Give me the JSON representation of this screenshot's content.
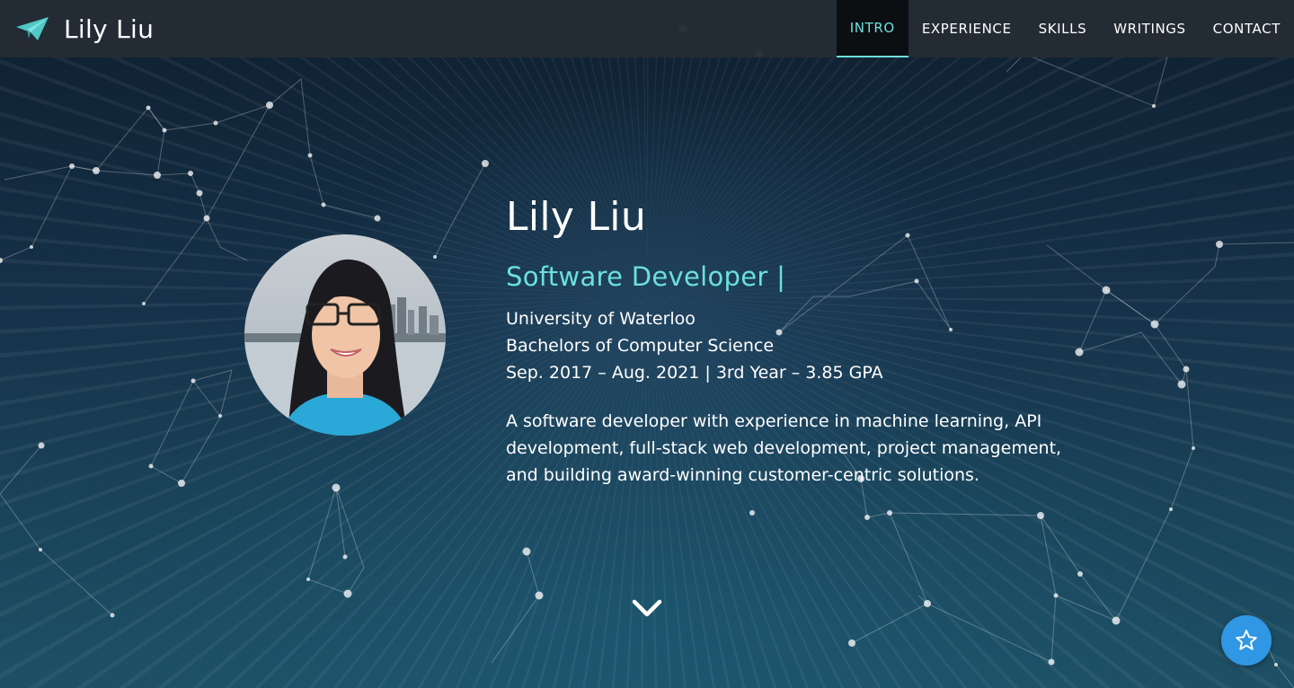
{
  "navbar": {
    "brand_name": "Lily Liu",
    "brand_icon": "paper-plane-icon",
    "items": [
      {
        "label": "INTRO",
        "active": true
      },
      {
        "label": "EXPERIENCE",
        "active": false
      },
      {
        "label": "SKILLS",
        "active": false
      },
      {
        "label": "WRITINGS",
        "active": false
      },
      {
        "label": "CONTACT",
        "active": false
      }
    ]
  },
  "hero": {
    "name": "Lily Liu",
    "role": "Software Developer |",
    "education": [
      "University of Waterloo",
      "Bachelors of Computer Science",
      "Sep. 2017 – Aug. 2021 | 3rd Year – 3.85 GPA"
    ],
    "summary": "A software developer with experience in machine learning, API development, full-stack web development, project management, and building award-winning customer-centric solutions."
  },
  "controls": {
    "scroll_icon": "chevron-down-icon",
    "fab_icon": "star-icon"
  },
  "colors": {
    "accent": "#6ce0dc",
    "navbar_bg": "#242c34",
    "fab": "#2f97e3"
  }
}
